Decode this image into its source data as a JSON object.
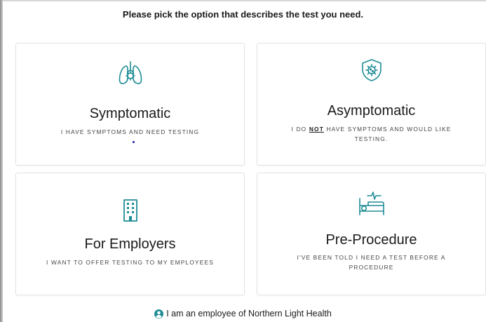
{
  "header": {
    "prompt": "Please pick the option that describes the test you need."
  },
  "options": [
    {
      "id": "symptomatic",
      "icon": "lungs-icon",
      "title": "Symptomatic",
      "subtitle": "I HAVE SYMPTOMS AND NEED TESTING"
    },
    {
      "id": "asymptomatic",
      "icon": "virus-shield-icon",
      "title": "Asymptomatic",
      "subtitle_pre": "I DO ",
      "subtitle_emph": "NOT",
      "subtitle_post_line1": " HAVE SYMPTOMS AND WOULD LIKE",
      "subtitle_line2": "TESTING."
    },
    {
      "id": "employers",
      "icon": "building-icon",
      "title": "For Employers",
      "subtitle": "I WANT TO OFFER TESTING TO MY EMPLOYEES"
    },
    {
      "id": "preprocedure",
      "icon": "hospital-bed-icon",
      "title": "Pre-Procedure",
      "subtitle_line1": "I'VE BEEN TOLD I NEED A TEST BEFORE A",
      "subtitle_line2": "PROCEDURE"
    }
  ],
  "footer": {
    "icon": "user-circle-icon",
    "text": "I am an employee of Northern Light Health"
  },
  "colors": {
    "accent": "#1f8c95",
    "card_border": "#e3e3e3",
    "text": "#1a1a1a"
  }
}
